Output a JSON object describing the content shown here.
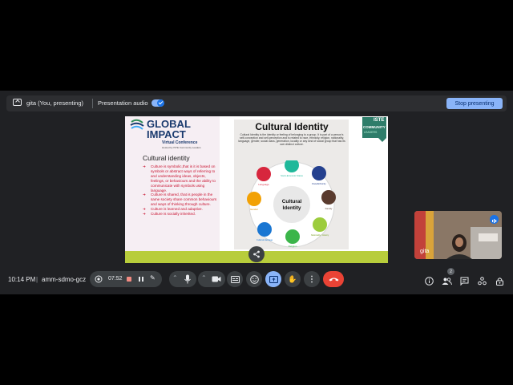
{
  "topbar": {
    "presenter_label": "gita (You, presenting)",
    "audio_label": "Presentation audio",
    "audio_on": true,
    "stop_label": "Stop presenting"
  },
  "slide": {
    "logo_line1": "GLOBAL",
    "logo_line2": "IMPACT",
    "logo_sub": "Virtual Conference",
    "logo_host": "Hosted by ISTE Community Leaders",
    "left_heading": "Cultural identity",
    "bullets": [
      "Culture is symbolic,that is it is based on symbols or abstract ways of referring to and understanding ideas, objects, feelings, or behaviours and the ability to communicate with symbols using language.",
      "Culture is shared, that is people in the same society share common behaviours and ways of thinking through culture.",
      "Culture is learned and adaptive.",
      "Culture is socially inherited."
    ],
    "right_title": "Cultural Identity",
    "right_desc": "Cultural Identity is the identity or feeling of belonging to a group. It is part of a person's self-conception and self-perception and is related to race, ethnicity, religion, nationality, language, gender, social class, generation, locality or any kind of social group that has its own distinct culture.",
    "wheel_center_line1": "Cultural",
    "wheel_center_line2": "Identity",
    "wheel_items": [
      "Language",
      "Socio-Economic Status",
      "Race/Ethnicity",
      "Gender",
      "Family",
      "Cultural Heritage",
      "Religion",
      "Nationality / History"
    ],
    "badge_iste": "ISTE",
    "badge_comm": "COMMUNITY",
    "badge_lead": "LEADERS"
  },
  "self_tile": {
    "name": "gita"
  },
  "bottom": {
    "time": "10:14 PM",
    "separator": "|",
    "meeting_code": "amm-sdmo-gcz",
    "rec_time": "07:52",
    "participant_count": "2"
  },
  "colors": {
    "accent": "#8ab4f8",
    "end_call": "#ea4335",
    "slide_bottom": "#b8cd3b",
    "bullet_red": "#c8102e"
  }
}
